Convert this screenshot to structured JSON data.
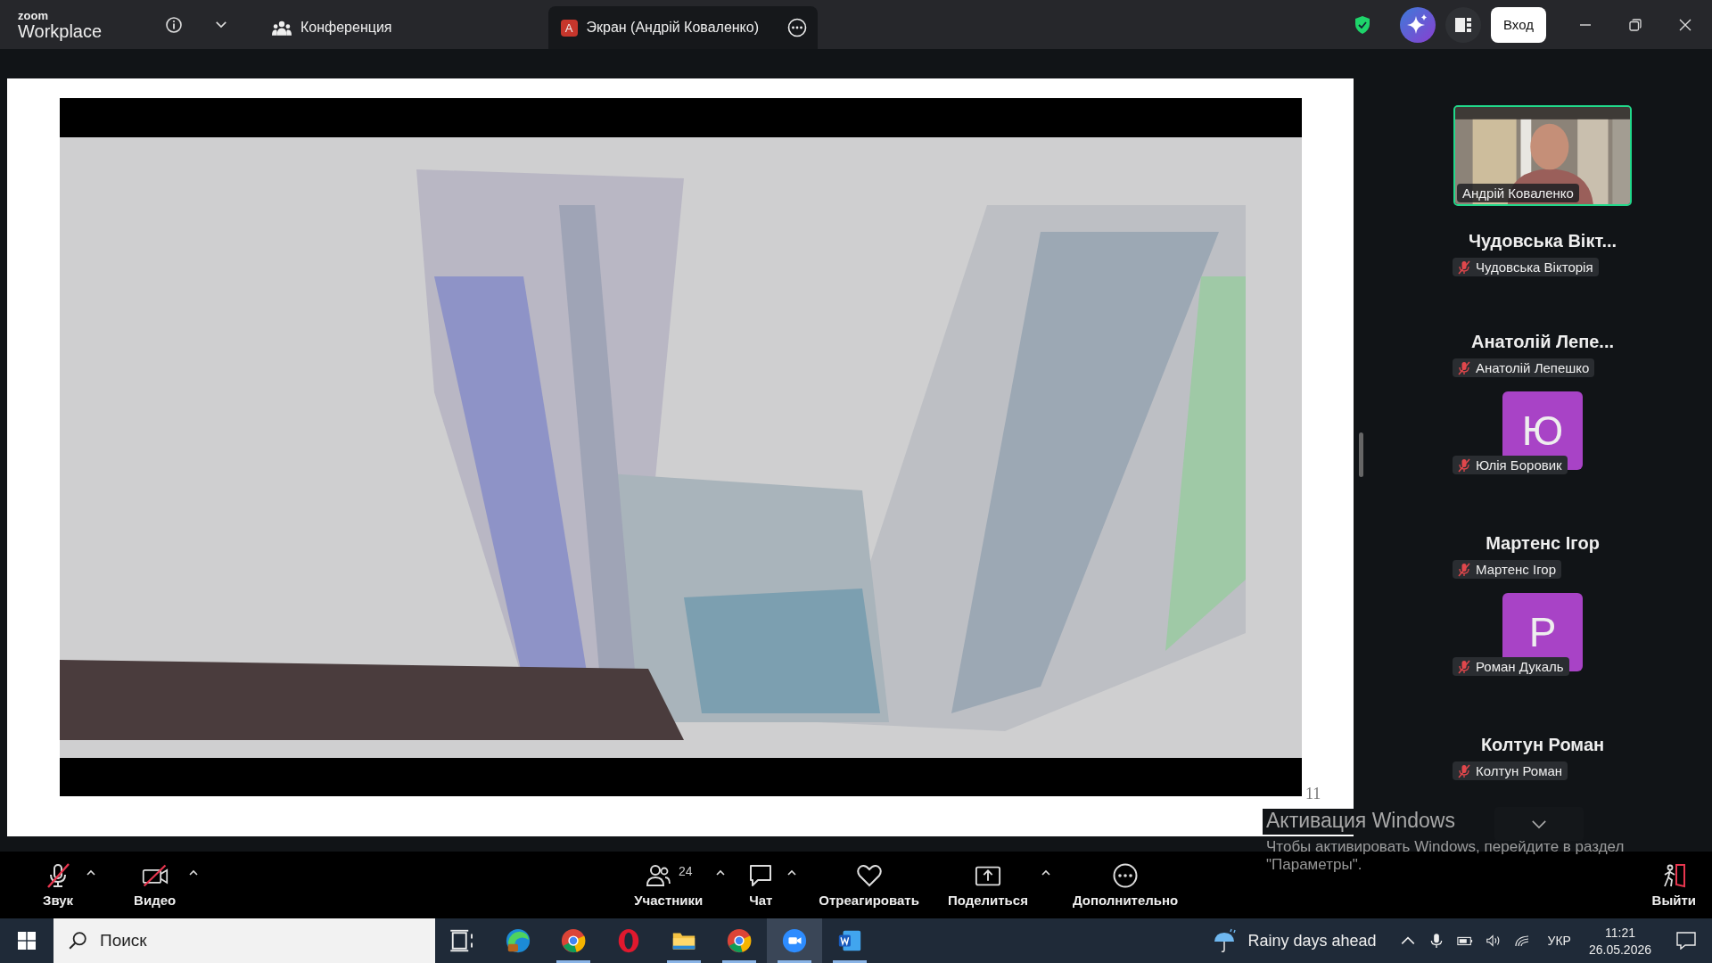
{
  "app": {
    "logo_top": "zoom",
    "logo_bottom": "Workplace"
  },
  "header": {
    "tabs": [
      {
        "label": "Конференция",
        "kind": "meeting",
        "selected": false
      },
      {
        "label": "Экран (Андрій Коваленко)",
        "kind": "share",
        "badge": "A",
        "selected": true
      }
    ],
    "sign_in": "Вход"
  },
  "slide": {
    "number": "11"
  },
  "participants": [
    {
      "kind": "video",
      "name": "Андрій Коваленко",
      "speaking": true
    },
    {
      "kind": "name",
      "title": "Чудовська Вікт...",
      "name": "Чудовська Вікторія",
      "muted": true
    },
    {
      "kind": "name",
      "title": "Анатолій Лепе...",
      "name": "Анатолій Лепешко",
      "muted": true
    },
    {
      "kind": "avatar",
      "initial": "Ю",
      "name": "Юлія Боровик",
      "muted": true
    },
    {
      "kind": "name",
      "title": "Мартенс Ігор",
      "name": "Мартенс Ігор",
      "muted": true
    },
    {
      "kind": "avatar",
      "initial": "P",
      "name": "Роман Дукаль",
      "muted": true
    },
    {
      "kind": "name",
      "title": "Колтун Роман",
      "name": "Колтун Роман",
      "muted": true
    }
  ],
  "toolbar": {
    "left": [
      {
        "label": "Звук",
        "kind": "audio",
        "muted": true,
        "caret": true
      },
      {
        "label": "Видео",
        "kind": "video",
        "muted": true,
        "caret": true
      }
    ],
    "center": [
      {
        "label": "Участники",
        "kind": "participants",
        "count": "24",
        "caret": true
      },
      {
        "label": "Чат",
        "kind": "chat",
        "caret": true
      },
      {
        "label": "Отреагировать",
        "kind": "react",
        "caret": false
      },
      {
        "label": "Поделиться",
        "kind": "share",
        "caret": true
      },
      {
        "label": "Дополнительно",
        "kind": "more",
        "caret": false
      }
    ],
    "leave": "Выйти"
  },
  "activation": {
    "title": "Активация Windows",
    "lines": [
      "Чтобы активировать Windows, перейдите в раздел",
      "\"Параметры\"."
    ]
  },
  "taskbar": {
    "search_placeholder": "Поиск",
    "apps": [
      {
        "kind": "edge",
        "running": false,
        "selected": false
      },
      {
        "kind": "chrome",
        "running": true,
        "selected": false
      },
      {
        "kind": "opera",
        "running": false,
        "selected": false
      },
      {
        "kind": "explorer",
        "running": true,
        "selected": false
      },
      {
        "kind": "chrome",
        "running": true,
        "selected": false
      },
      {
        "kind": "zoom",
        "running": true,
        "selected": true
      },
      {
        "kind": "word",
        "running": true,
        "selected": false
      }
    ],
    "weather": "Rainy days ahead",
    "language": "УКР",
    "time": "11:21",
    "date": "26.05.2026"
  }
}
